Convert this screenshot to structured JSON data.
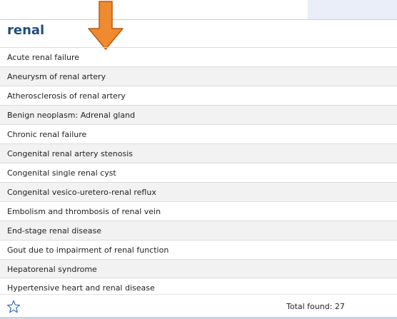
{
  "search_term": "renal",
  "results": [
    "Acute renal failure",
    "Aneurysm of renal artery",
    "Atherosclerosis of renal artery",
    "Benign neoplasm: Adrenal gland",
    "Chronic renal failure",
    "Congenital renal artery stenosis",
    "Congenital single renal cyst",
    "Congenital vesico-uretero-renal reflux",
    "Embolism and thrombosis of renal vein",
    "End-stage renal disease",
    "Gout due to impairment of renal function",
    "Hepatorenal syndrome",
    "Hypertensive heart and renal disease"
  ],
  "footer": {
    "total_label": "Total found: 27",
    "favorite_icon": "star-outline-icon"
  },
  "colors": {
    "arrow": "#f08a2e",
    "title": "#1f4e79",
    "star": "#3a6fb0"
  }
}
